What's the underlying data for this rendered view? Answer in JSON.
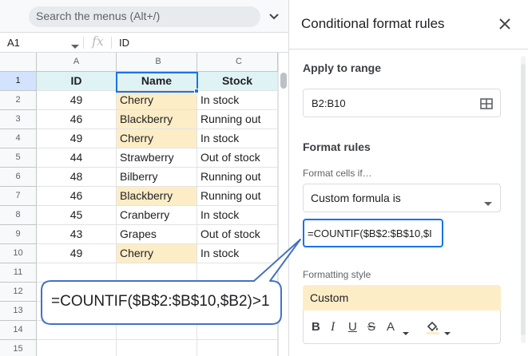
{
  "menubar": {
    "search_placeholder": "Search the menus (Alt+/)"
  },
  "formula_bar": {
    "name_box": "A1",
    "fx": "fx",
    "value": "ID"
  },
  "grid": {
    "columns": [
      "A",
      "B",
      "C"
    ],
    "row_numbers": [
      "1",
      "2",
      "3",
      "4",
      "5",
      "6",
      "7",
      "8",
      "9",
      "10",
      "11",
      "12",
      "13",
      "14",
      "15"
    ],
    "header_row": [
      "ID",
      "Name",
      "Stock"
    ],
    "rows": [
      {
        "id": "49",
        "name": "Cherry",
        "stock": "In stock"
      },
      {
        "id": "46",
        "name": "Blackberry",
        "stock": "Running out"
      },
      {
        "id": "49",
        "name": "Cherry",
        "stock": "In stock"
      },
      {
        "id": "44",
        "name": "Strawberry",
        "stock": "Out of stock"
      },
      {
        "id": "48",
        "name": "Bilberry",
        "stock": "Running out"
      },
      {
        "id": "46",
        "name": "Blackberry",
        "stock": "Running out"
      },
      {
        "id": "45",
        "name": "Cranberry",
        "stock": "In stock"
      },
      {
        "id": "43",
        "name": "Grapes",
        "stock": "Out of stock"
      },
      {
        "id": "49",
        "name": "Cherry",
        "stock": "In stock"
      }
    ],
    "highlight_color": "#fdedc7",
    "header_fill_color": "#dff3f5"
  },
  "callout": {
    "text": "=COUNTIF($B$2:$B$10,$B2)>1",
    "border_color": "#4472c4"
  },
  "panel": {
    "title": "Conditional format rules",
    "close_icon": "close-icon",
    "apply_to_range_label": "Apply to range",
    "range_value": "B2:B10",
    "format_rules_label": "Format rules",
    "format_cells_if_label": "Format cells if…",
    "condition_value": "Custom formula is",
    "formula_value": "=COUNTIF($B$2:$B$10,$I",
    "formatting_style_label": "Formatting style",
    "style_preview": "Custom",
    "toolbar": {
      "bold": "B",
      "italic": "I",
      "underline": "U",
      "strikethrough": "S",
      "text_color": "A"
    },
    "accent_color": "#1a73e8"
  }
}
